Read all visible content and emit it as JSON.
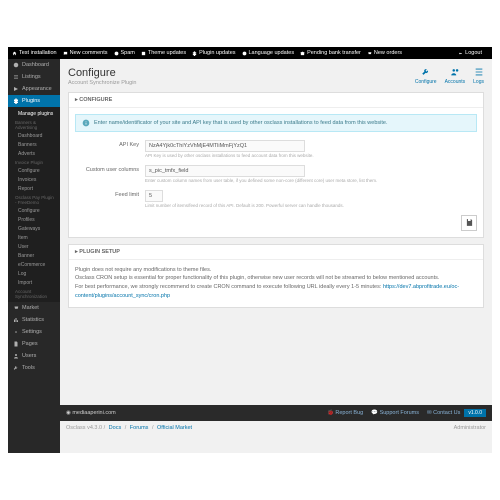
{
  "topbar": {
    "items": [
      "Test installation",
      "New comments",
      "Spam",
      "Theme updates",
      "Plugin updates",
      "Language updates",
      "Pending bank transfer",
      "New orders"
    ],
    "logout": "Logout"
  },
  "sidebar": {
    "main": [
      {
        "id": "dashboard",
        "label": "Dashboard"
      },
      {
        "id": "listings",
        "label": "Listings"
      },
      {
        "id": "appearance",
        "label": "Appearance"
      }
    ],
    "plugins": {
      "label": "Plugins"
    },
    "sub": {
      "manage": "Manage plugins",
      "groups": [
        {
          "header": "Banners & Advertising",
          "items": [
            "Dashboard",
            "Banners",
            "Adverts"
          ]
        },
        {
          "header": "Invoice Plugin",
          "items": [
            "Configure",
            "Invoices",
            "Report"
          ]
        },
        {
          "header": "Osclass Pay Plugin - FreeDemo",
          "items": [
            "Configure",
            "Profiles",
            "Gateways",
            "Item",
            "User",
            "Banner",
            "eCommerce",
            "Log",
            "Import"
          ]
        },
        {
          "header": "Account Synchronization",
          "items": []
        }
      ]
    },
    "bottom": [
      {
        "id": "market",
        "label": "Market"
      },
      {
        "id": "statistics",
        "label": "Statistics"
      },
      {
        "id": "settings",
        "label": "Settings"
      },
      {
        "id": "pages",
        "label": "Pages"
      },
      {
        "id": "users",
        "label": "Users"
      },
      {
        "id": "tools",
        "label": "Tools"
      }
    ]
  },
  "header": {
    "title": "Configure",
    "subtitle": "Account Synchronize Plugin",
    "actions": [
      {
        "id": "configure",
        "label": "Configure"
      },
      {
        "id": "accounts",
        "label": "Accounts"
      },
      {
        "id": "logs",
        "label": "Logs"
      }
    ]
  },
  "configure": {
    "panel_title": "CONFIGURE",
    "info": "Enter name/identificator of your site and API key that is used by other osclass installations to feed data from this website.",
    "fields": {
      "apikey": {
        "label": "API Key",
        "value": "NzA4Yjk0cThiYzVhMjE4MTliMmFjYzQ1",
        "help": "API Key is used by other osclass installations to feed account data from this website."
      },
      "columns": {
        "label": "Custom user columns",
        "value": "s_pic_tmfx_field",
        "help": "Enter custom column names from user table, if you defined some non-core (different core) user meta store, list them."
      },
      "limit": {
        "label": "Feed limit",
        "value": "5",
        "help": "Limit number of items/feed record of this API. Default is 200. Powerful server can handle thousands."
      }
    }
  },
  "setup": {
    "panel_title": "PLUGIN SETUP",
    "l1": "Plugin does not require any modifications to theme files.",
    "l2": "Osclass CRON setup is essential for proper functionality of this plugin, otherwise new user records will not be streamed to below mentioned accounts.",
    "l3a": "For best performance, we strongly recommend to create CRON command to execute following URL ideally every 1-5 minutes: ",
    "l3b": "https://dev7.abprofitrade.eu/oc-content/plugins/account_sync/cron.php"
  },
  "footer": {
    "brand": "mediaaperini.com",
    "links": [
      "Report Bug",
      "Support Forums",
      "Contact Us"
    ],
    "version": "v1.0.0",
    "breadcrumb": [
      "Osclass v4.3.0",
      "Docs",
      "Forums",
      "Official Market"
    ],
    "admin": "Administrator"
  }
}
